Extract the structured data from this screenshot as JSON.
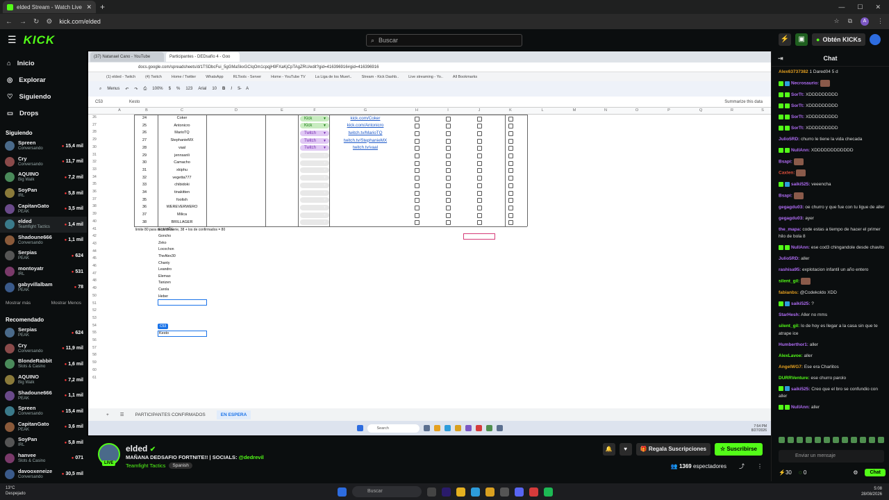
{
  "browser": {
    "tab_title": "elded Stream - Watch Live",
    "url": "kick.com/elded"
  },
  "header": {
    "logo": "KICK",
    "search_placeholder": "Buscar",
    "get_kicks": "Obtén KICKs"
  },
  "sidebar": {
    "main_nav": [
      "Inicio",
      "Explorar",
      "Siguiendo",
      "Drops"
    ],
    "following_title": "Siguiendo",
    "following": [
      {
        "name": "Spreen",
        "cat": "Conversando",
        "viewers": "15,4 mil"
      },
      {
        "name": "Cry",
        "cat": "Conversando",
        "viewers": "11,7 mil"
      },
      {
        "name": "AQUINO",
        "cat": "Big Walk",
        "viewers": "7,2 mil"
      },
      {
        "name": "SoyPan",
        "cat": "IRL",
        "viewers": "5,8 mil"
      },
      {
        "name": "CapitanGato",
        "cat": "PEAK",
        "viewers": "3,5 mil"
      },
      {
        "name": "elded",
        "cat": "Teamfight Tactics",
        "viewers": "1,4 mil"
      },
      {
        "name": "Shadoune666",
        "cat": "Conversando",
        "viewers": "1,1 mil"
      },
      {
        "name": "Serpias",
        "cat": "PEAK",
        "viewers": "624"
      },
      {
        "name": "montoyatr",
        "cat": "IRL",
        "viewers": "531"
      },
      {
        "name": "gabyvillalbam",
        "cat": "PEAK",
        "viewers": "78"
      }
    ],
    "more": "Mostrar más",
    "less": "Mostrar Menos",
    "recommended_title": "Recomendado",
    "recommended": [
      {
        "name": "Serpias",
        "cat": "PEAK",
        "viewers": "624"
      },
      {
        "name": "Cry",
        "cat": "Conversando",
        "viewers": "11,9 mil"
      },
      {
        "name": "BlondeRabbit",
        "cat": "Slots & Casino",
        "viewers": "1,6 mil"
      },
      {
        "name": "AQUINO",
        "cat": "Big Walk",
        "viewers": "7,2 mil"
      },
      {
        "name": "Shadoune666",
        "cat": "PEAK",
        "viewers": "1,1 mil"
      },
      {
        "name": "Spreen",
        "cat": "Conversando",
        "viewers": "15,4 mil"
      },
      {
        "name": "CapitanGato",
        "cat": "PEAK",
        "viewers": "3,6 mil"
      },
      {
        "name": "SoyPan",
        "cat": "IRL",
        "viewers": "5,8 mil"
      },
      {
        "name": "hanvee",
        "cat": "Slots & Casino",
        "viewers": "071"
      },
      {
        "name": "davooxeneize",
        "cat": "Conversando",
        "viewers": "30,5 mil"
      }
    ]
  },
  "video": {
    "tabs": [
      "(37) Natanael Cano - YouTube",
      "Participantes - DEDsafío 4 - Goo"
    ],
    "address": "docs.google.com/spreadsheets/d/1TSDbcFui_5gGMaSkxGCIqOm1cpqjH9FXaKjCpTAgZRU/edit?gid=416396916#gid=416396916",
    "bookmarks": [
      "(1) elded - Twitch",
      "(4) Twitch",
      "Home / Twitter",
      "WhatsApp",
      "RLTools - Server",
      "Home - YouTube TV",
      "La Liga de los Muert..",
      "Stream - Kick Dashb..",
      "Live streaming - Yo..",
      "All Bookmarks"
    ],
    "toolbar": [
      "Menus",
      "100%",
      "123",
      "Arial",
      "10"
    ],
    "cell_ref": "C53",
    "formula": "Kesto",
    "summarize": "Summarize this data",
    "columns": [
      "A",
      "B",
      "C",
      "D",
      "E",
      "F",
      "G",
      "H",
      "I",
      "J",
      "K",
      "L",
      "M",
      "N",
      "O",
      "P",
      "Q",
      "R",
      "S"
    ],
    "rows": [
      {
        "n": "24",
        "name": "Coker",
        "plat": "Kick",
        "link": "kick.com/Coker"
      },
      {
        "n": "25",
        "name": "Antonicro",
        "plat": "Kick",
        "link": "kick.com/Antonicro"
      },
      {
        "n": "26",
        "name": "MarioTQ",
        "plat": "Twitch",
        "link": "twitch.tv/MarioTQ"
      },
      {
        "n": "27",
        "name": "StephanieMX",
        "plat": "Twitch",
        "link": "twitch.tv/StephanieMX"
      },
      {
        "n": "28",
        "name": "vaal",
        "plat": "Twitch",
        "link": "twitch.tv/vaal"
      },
      {
        "n": "29",
        "name": "jennsanli",
        "plat": "",
        "link": ""
      },
      {
        "n": "30",
        "name": "Camacho",
        "plat": "",
        "link": ""
      },
      {
        "n": "31",
        "name": "xkiphu",
        "plat": "",
        "link": ""
      },
      {
        "n": "32",
        "name": "vegetta777",
        "plat": "",
        "link": ""
      },
      {
        "n": "33",
        "name": "chibidoki",
        "plat": "",
        "link": ""
      },
      {
        "n": "34",
        "name": "tinakitten",
        "plat": "",
        "link": ""
      },
      {
        "n": "35",
        "name": "foolish",
        "plat": "",
        "link": ""
      },
      {
        "n": "36",
        "name": "WEREVERWERO",
        "plat": "",
        "link": ""
      },
      {
        "n": "37",
        "name": "Milica",
        "plat": "",
        "link": ""
      },
      {
        "n": "38",
        "name": "BRILLAGER",
        "plat": "",
        "link": ""
      }
    ],
    "note": "limite 80 para inicio de serie, 38 + los de confirmados = 80",
    "waiting": [
      "ELMUÑE",
      "Goncho",
      "Zeko",
      "Locochon",
      "TheAlex30",
      "Chanty",
      "Leandro",
      "Elemao",
      "Tanizen",
      "Carola",
      "Heber"
    ],
    "edit_tag": "C53",
    "edit_value": "Kesto",
    "sheet_tabs": [
      "PARTICIPANTES CONFIRMADOS",
      "EN ESPERA"
    ],
    "taskbar_search": "Search",
    "time": "7:54 PM",
    "date": "8/27/2026"
  },
  "stream": {
    "streamer": "elded",
    "title": "MAÑANA DEDSAFIO FORTNITE!! | SOCIALS: ",
    "social": "@dedrevil",
    "category": "Teamfight Tactics",
    "language": "Spanish",
    "live": "LIVE",
    "gift": "Regala Suscripciones",
    "subscribe": "Suscribirse",
    "viewers": "1369",
    "viewers_label": "espectadores"
  },
  "chat": {
    "title": "Chat",
    "messages": [
      {
        "user": "Alex63737382",
        "color": "#e5a020",
        "text": "1  Dared04 5 d",
        "badge": ""
      },
      {
        "user": "Necrosaurio:",
        "color": "#b06cf5",
        "text": "",
        "badge": "blue",
        "emote": true
      },
      {
        "user": "SorTt:",
        "color": "#b06cf5",
        "text": "XDDDDDDDDD",
        "badge": "green"
      },
      {
        "user": "SorTt:",
        "color": "#b06cf5",
        "text": "XDDDDDDDDD",
        "badge": "green"
      },
      {
        "user": "SorTt:",
        "color": "#b06cf5",
        "text": "XDDDDDDDDD",
        "badge": "green"
      },
      {
        "user": "SorTt:",
        "color": "#b06cf5",
        "text": "XDDDDDDDDD",
        "badge": "green"
      },
      {
        "user": "Julio5RD:",
        "color": "#b06cf5",
        "text": "churro le tiene la vida checada",
        "badge": ""
      },
      {
        "user": "NullAnn:",
        "color": "#b06cf5",
        "text": "XDDDDDDDDDDDD",
        "badge": "green"
      },
      {
        "user": "Bsapi:",
        "color": "#b06cf5",
        "text": "",
        "badge": "",
        "emote": true
      },
      {
        "user": "Caxlen:",
        "color": "#e0503c",
        "text": "",
        "badge": "",
        "emote": true
      },
      {
        "user": "saiki525:",
        "color": "#b06cf5",
        "text": "veeencha",
        "badge": "blue"
      },
      {
        "user": "Bsapi:",
        "color": "#b06cf5",
        "text": "",
        "badge": "",
        "emote": true
      },
      {
        "user": "gegagdu03:",
        "color": "#b06cf5",
        "text": "oe churro y que fue con tu ligue de aller",
        "badge": ""
      },
      {
        "user": "gegagdu03:",
        "color": "#b06cf5",
        "text": "ayer",
        "badge": ""
      },
      {
        "user": "the_mapa:",
        "color": "#b06cf5",
        "text": "code estas a tiempo de hacer el primer hilo de bola 8",
        "badge": ""
      },
      {
        "user": "NullAnn:",
        "color": "#b06cf5",
        "text": "ese cod3 chingandole desde chavito",
        "badge": "green"
      },
      {
        "user": "Julio5RD:",
        "color": "#b06cf5",
        "text": "aller",
        "badge": ""
      },
      {
        "user": "rashisa95:",
        "color": "#b06cf5",
        "text": "explotacion infantil un año entero",
        "badge": ""
      },
      {
        "user": "silent_gil:",
        "color": "#53fc18",
        "text": "",
        "badge": "",
        "emote": true
      },
      {
        "user": "fabianbs:",
        "color": "#e5a020",
        "text": "@Codekoldo XDD",
        "badge": ""
      },
      {
        "user": "saiki525:",
        "color": "#b06cf5",
        "text": "?",
        "badge": "blue"
      },
      {
        "user": "StarHesh:",
        "color": "#b06cf5",
        "text": "Aller no mms",
        "badge": ""
      },
      {
        "user": "silent_gil:",
        "color": "#53fc18",
        "text": "lo de hoy es llegar a la casa sin que te atrape ice",
        "badge": ""
      },
      {
        "user": "Humberthor1:",
        "color": "#b06cf5",
        "text": "aller",
        "badge": ""
      },
      {
        "user": "AlexLavoe:",
        "color": "#53fc18",
        "text": "aller",
        "badge": ""
      },
      {
        "user": "AngelWG7:",
        "color": "#e5a020",
        "text": "Ese era Charlitos",
        "badge": ""
      },
      {
        "user": "DURRVenture:",
        "color": "#53fc18",
        "text": "ese churro parolo",
        "badge": ""
      },
      {
        "user": "saiki525:",
        "color": "#b06cf5",
        "text": "Creo que el bro se confundio con aller",
        "badge": "blue"
      },
      {
        "user": "NullAnn:",
        "color": "#b06cf5",
        "text": "aller",
        "badge": "green"
      }
    ],
    "input_placeholder": "Enviar un mensaje",
    "count1": "30",
    "count2": "0",
    "send": "Chat"
  },
  "taskbar": {
    "temp": "13°C",
    "weather": "Despejado",
    "search": "Buscar",
    "time": "5:08",
    "date": "28/08/2026"
  }
}
